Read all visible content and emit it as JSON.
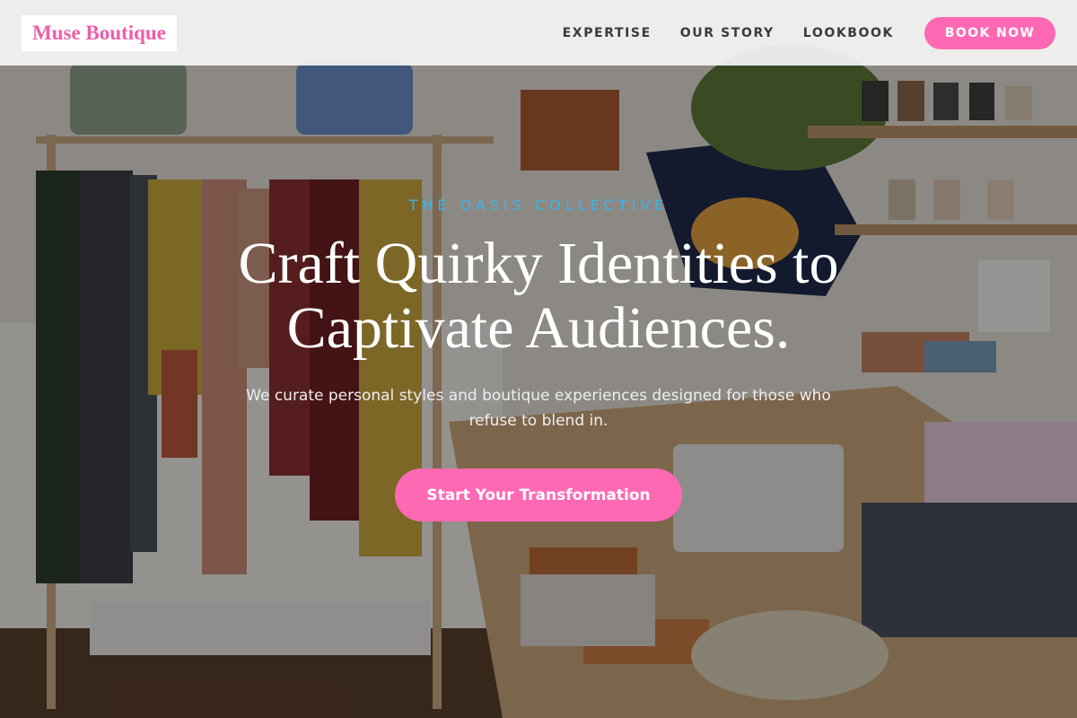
{
  "header": {
    "logo_text": "Muse Boutique",
    "nav": [
      {
        "label": "EXPERTISE"
      },
      {
        "label": "OUR STORY"
      },
      {
        "label": "LOOKBOOK"
      }
    ],
    "book_button": "BOOK NOW"
  },
  "hero": {
    "eyebrow": "THE OASIS COLLECTIVE",
    "headline_line1": "Craft Quirky Identities to",
    "headline_line2": "Captivate Audiences.",
    "subtext": "We curate personal styles and boutique experiences designed for those who refuse to blend in.",
    "cta_label": "Start Your Transformation"
  },
  "colors": {
    "accent_pink": "#ff69b4",
    "logo_pink": "#ee5ea8",
    "eyebrow_blue": "#3ab4e8",
    "navbar_bg": "#f4f4f4"
  },
  "icons": []
}
